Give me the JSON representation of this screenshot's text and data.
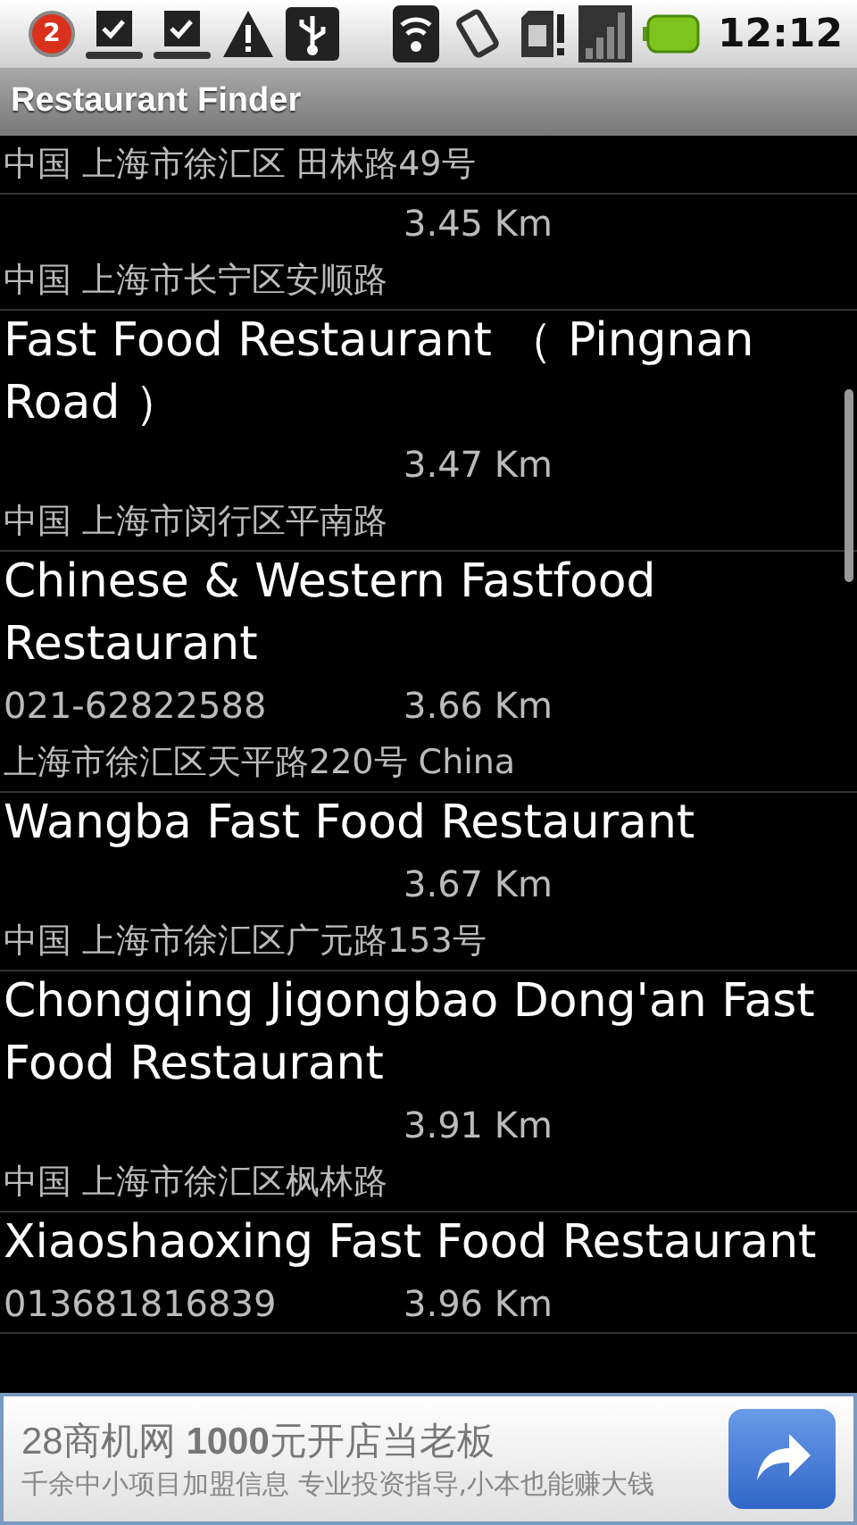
{
  "status_bar": {
    "notification_count": "2",
    "time": "12:12"
  },
  "window": {
    "title": "Restaurant Finder"
  },
  "restaurants": [
    {
      "address": "中国 上海市徐汇区 田林路49号"
    },
    {
      "distance": "3.45 Km",
      "address": "中国 上海市长宁区安顺路"
    },
    {
      "name": "Fast Food Restaurant （ Pingnan Road ）",
      "distance": "3.47 Km",
      "address": "中国 上海市闵行区平南路"
    },
    {
      "name": "Chinese & Western Fastfood Restaurant",
      "phone": "021-62822588",
      "distance": "3.66 Km",
      "address": "上海市徐汇区天平路220号 China"
    },
    {
      "name": "Wangba Fast Food Restaurant",
      "distance": "3.67 Km",
      "address": "中国 上海市徐汇区广元路153号"
    },
    {
      "name": "Chongqing Jigongbao Dong'an Fast Food Restaurant",
      "distance": "3.91 Km",
      "address": "中国 上海市徐汇区枫林路"
    },
    {
      "name": "Xiaoshaoxing Fast Food Restaurant",
      "phone": "013681816839",
      "distance": "3.96 Km"
    }
  ],
  "ad": {
    "headline": "28商机网 **1000**元开店当老板",
    "body": "千余中小项目加盟信息 专业投资指导,小本也能赚大钱"
  }
}
